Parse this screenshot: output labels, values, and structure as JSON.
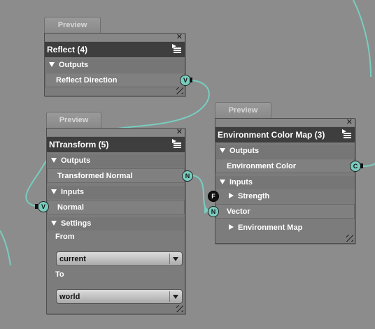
{
  "nodes": {
    "reflect": {
      "preview_tab": "Preview",
      "title": "Reflect (4)",
      "outputs_label": "Outputs",
      "outputs": [
        {
          "label": "Reflect Direction",
          "socket": "V"
        }
      ]
    },
    "ntransform": {
      "preview_tab": "Preview",
      "title": "NTransform (5)",
      "outputs_label": "Outputs",
      "outputs": [
        {
          "label": "Transformed Normal",
          "socket": "N"
        }
      ],
      "inputs_label": "Inputs",
      "inputs": [
        {
          "label": "Normal",
          "socket": "V"
        }
      ],
      "settings_label": "Settings",
      "from_label": "From",
      "from_value": "current",
      "to_label": "To",
      "to_value": "world"
    },
    "envmap": {
      "preview_tab": "Preview",
      "title": "Environment Color Map (3)",
      "outputs_label": "Outputs",
      "outputs": [
        {
          "label": "Environment Color",
          "socket": "C"
        }
      ],
      "inputs_label": "Inputs",
      "inputs": [
        {
          "label": "Strength",
          "socket": "F"
        },
        {
          "label": "Vector",
          "socket": "N"
        },
        {
          "label": "Environment Map"
        }
      ]
    }
  },
  "icons": {
    "close": "close-icon",
    "menu": "menu-icon",
    "resize": "resize-grip-icon"
  },
  "colors": {
    "background": "#8c8c8c",
    "socket": "#78cdbf",
    "wire": "#78cdbf",
    "title_bar": "#3e3e3e"
  }
}
